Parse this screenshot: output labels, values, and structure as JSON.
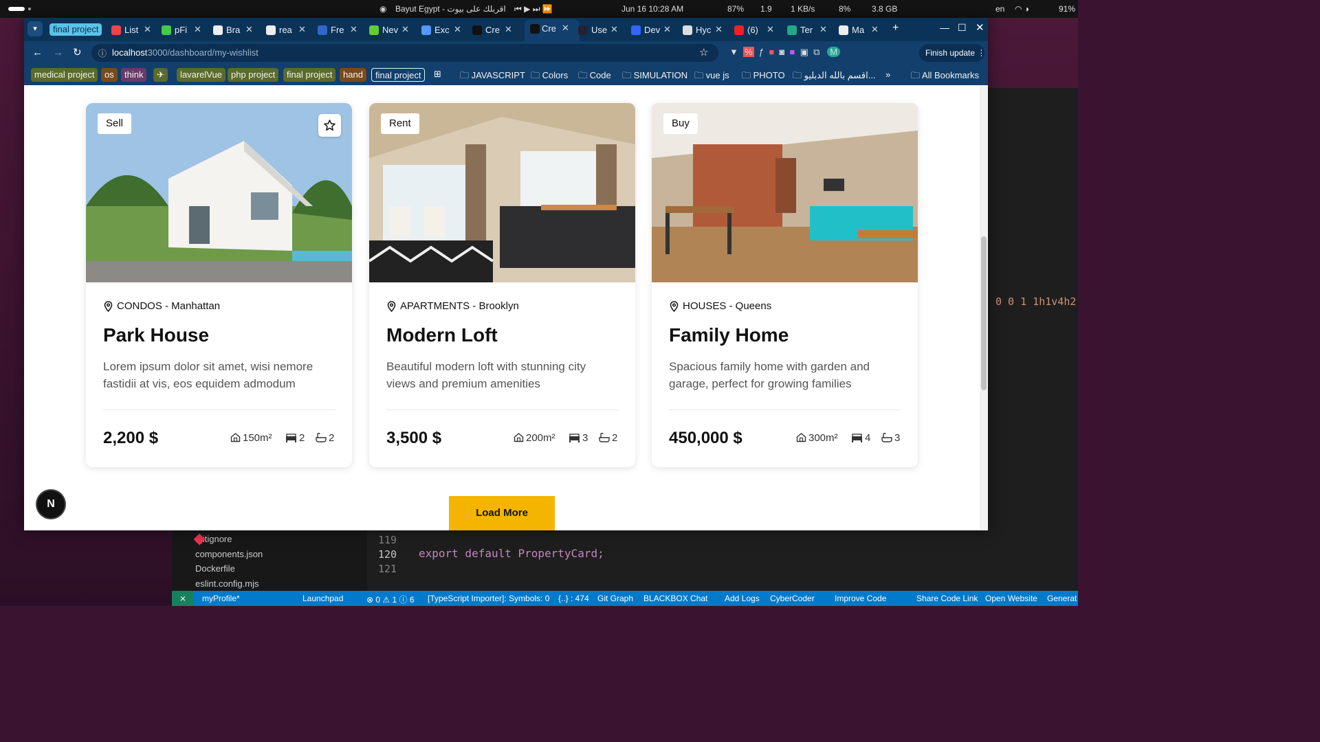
{
  "system": {
    "center_title": "Bayut Egypt - اقربلك على بيوت",
    "date_time": "Jun 16  10:28 AM",
    "stats": [
      "87%",
      "1.9",
      "1 KB/s",
      "8%",
      "3.8 GB"
    ],
    "lang": "en",
    "battery": "91%"
  },
  "tabs": [
    {
      "label": "final project",
      "kind": "group"
    },
    {
      "label": "List",
      "color": "#e44"
    },
    {
      "label": "pFi",
      "color": "#4c4"
    },
    {
      "label": "Bra",
      "color": "#eee"
    },
    {
      "label": "rea",
      "color": "#eee"
    },
    {
      "label": "Fre",
      "color": "#36c"
    },
    {
      "label": "Nev",
      "color": "#6c3"
    },
    {
      "label": "Exc",
      "color": "#59f"
    },
    {
      "label": "Cre",
      "color": "#111"
    },
    {
      "label": "Cre",
      "color": "#111",
      "active": true
    },
    {
      "label": "Use",
      "color": "#223"
    },
    {
      "label": "Dev",
      "color": "#36f"
    },
    {
      "label": "Hyc",
      "color": "#ddd"
    },
    {
      "label": "(6)",
      "color": "#e22"
    },
    {
      "label": "Ter",
      "color": "#2a8"
    },
    {
      "label": "Ma",
      "color": "#eee"
    }
  ],
  "address_bar": {
    "host": "localhost",
    "path": ":3000/dashboard/my-wishlist",
    "finish_update": "Finish update"
  },
  "bookmarks": {
    "groups": [
      {
        "label": "medical project",
        "bg": "#5a6b2a"
      },
      {
        "label": "os",
        "bg": "#7a4a1a"
      },
      {
        "label": "think",
        "bg": "#6a3a6a"
      },
      {
        "label": "lavarelVue",
        "bg": "#5a6b2a"
      },
      {
        "label": "php project",
        "bg": "#5a6b2a"
      },
      {
        "label": "final project",
        "bg": "#5a6b2a"
      },
      {
        "label": "hand",
        "bg": "#7a4a1a"
      },
      {
        "label": "final project",
        "bg": "#1a6a7a"
      }
    ],
    "folders": [
      "JAVASCRIPT",
      "Colors",
      "Code",
      "SIMULATION",
      "vue js",
      "PHOTO",
      "اقسم بالله الدبليو...",
      "All Bookmarks"
    ]
  },
  "cards": [
    {
      "badge": "Sell",
      "favorite": true,
      "location": "CONDOS - Manhattan",
      "title": "Park House",
      "description": "Lorem ipsum dolor sit amet, wisi nemore fastidii at vis, eos equidem admodum",
      "price": "2,200 $",
      "area": "150m²",
      "beds": "2",
      "baths": "2"
    },
    {
      "badge": "Rent",
      "favorite": false,
      "location": "APARTMENTS - Brooklyn",
      "title": "Modern Loft",
      "description": "Beautiful modern loft with stunning city views and premium amenities",
      "price": "3,500 $",
      "area": "200m²",
      "beds": "3",
      "baths": "2"
    },
    {
      "badge": "Buy",
      "favorite": false,
      "location": "HOUSES - Queens",
      "title": "Family Home",
      "description": "Spacious family home with garden and garage, perfect for growing families",
      "price": "450,000 $",
      "area": "300m²",
      "beds": "4",
      "baths": "3"
    }
  ],
  "load_more": "Load More",
  "next_badge": "N",
  "editor": {
    "files": [
      ".gitignore",
      "components.json",
      "Dockerfile",
      "eslint.config.mjs"
    ],
    "line_numbers": [
      "119",
      "120",
      "121"
    ],
    "code_line": "export default PropertyCard;",
    "side_text": "0 0 1 1h1v4h2"
  },
  "statusbar": [
    "myProfile*",
    "Launchpad",
    "0",
    "1",
    "6",
    "[TypeScript Importer]: Symbols: 0",
    "{..} : 474",
    "Git Graph",
    "BLACKBOX Chat",
    "Add Logs",
    "CyberCoder",
    "Improve Code",
    "Share Code Link",
    "Open Website",
    "Generat"
  ]
}
